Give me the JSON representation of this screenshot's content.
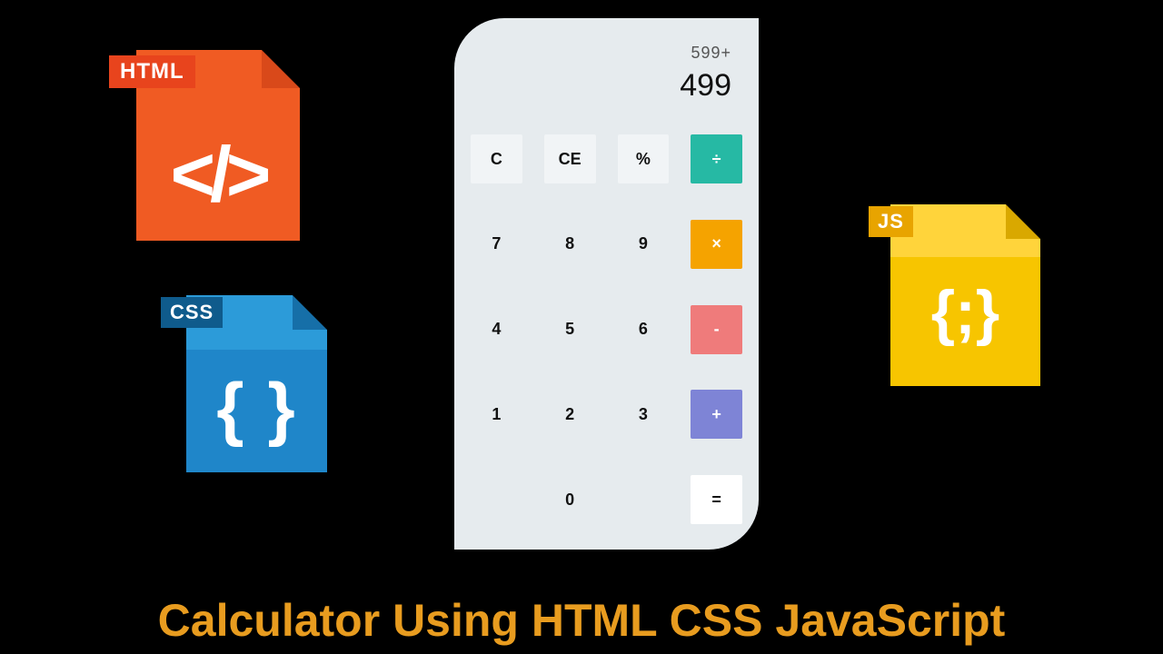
{
  "title": "Calculator Using HTML CSS JavaScript",
  "calculator": {
    "history": "599+",
    "current": "499",
    "buttons": {
      "clear": "C",
      "clear_entry": "CE",
      "percent": "%",
      "divide": "÷",
      "seven": "7",
      "eight": "8",
      "nine": "9",
      "multiply": "×",
      "four": "4",
      "five": "5",
      "six": "6",
      "subtract": "-",
      "one": "1",
      "two": "2",
      "three": "3",
      "add": "+",
      "zero": "0",
      "equals": "="
    }
  },
  "file_icons": {
    "html_label": "HTML",
    "html_glyph": "</>",
    "css_label": "CSS",
    "css_glyph": "{ }",
    "js_label": "JS",
    "js_glyph": "{;}"
  }
}
